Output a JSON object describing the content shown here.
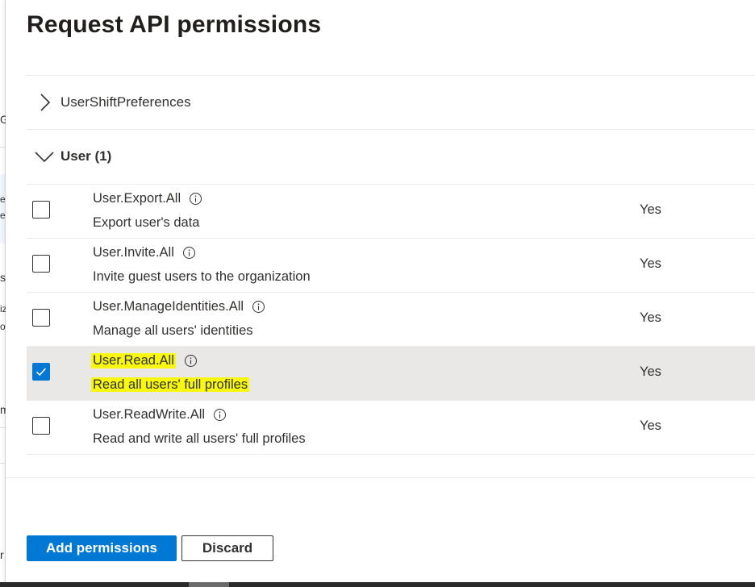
{
  "background_fragments": [
    "G",
    "er",
    "e",
    "si",
    "iz",
    "oi",
    "m",
    "r"
  ],
  "panel": {
    "title": "Request API permissions"
  },
  "groups": [
    {
      "label": "UserShiftPreferences",
      "expanded": false,
      "icon": "chevron-right-icon"
    },
    {
      "label": "User (1)",
      "expanded": true,
      "icon": "chevron-down-icon"
    }
  ],
  "permissions": [
    {
      "name": "User.Export.All",
      "description": "Export user's data",
      "admin_consent": "Yes",
      "checked": false,
      "highlighted": false
    },
    {
      "name": "User.Invite.All",
      "description": "Invite guest users to the organization",
      "admin_consent": "Yes",
      "checked": false,
      "highlighted": false
    },
    {
      "name": "User.ManageIdentities.All",
      "description": "Manage all users' identities",
      "admin_consent": "Yes",
      "checked": false,
      "highlighted": false
    },
    {
      "name": "User.Read.All",
      "description": "Read all users' full profiles",
      "admin_consent": "Yes",
      "checked": true,
      "highlighted": true
    },
    {
      "name": "User.ReadWrite.All",
      "description": "Read and write all users' full profiles",
      "admin_consent": "Yes",
      "checked": false,
      "highlighted": false
    }
  ],
  "footer": {
    "add_label": "Add permissions",
    "discard_label": "Discard"
  },
  "colors": {
    "accent": "#0078d4",
    "highlight": "#f7f711",
    "selected_row": "#e9e8e6"
  }
}
